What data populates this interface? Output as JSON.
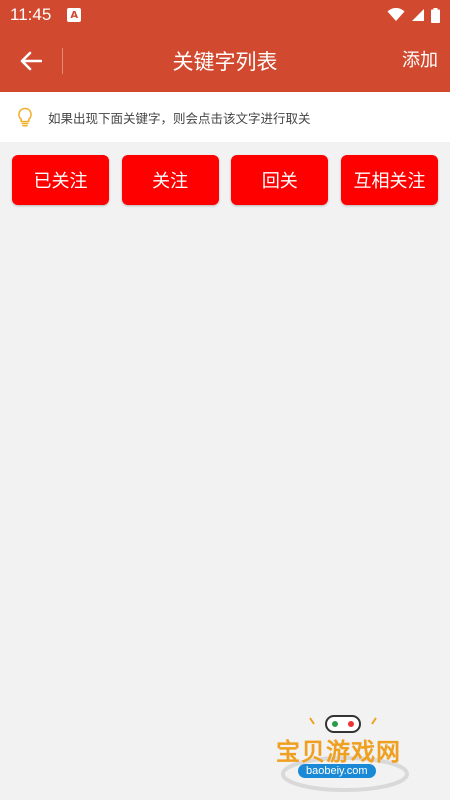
{
  "status_bar": {
    "time": "11:45",
    "notification_glyph": "A"
  },
  "toolbar": {
    "title": "关键字列表",
    "add_label": "添加"
  },
  "hint": {
    "icon": "lightbulb-icon",
    "text": "如果出现下面关键字，则会点击该文字进行取关"
  },
  "keywords": [
    "已关注",
    "关注",
    "回关",
    "互相关注"
  ],
  "watermark": {
    "title": "宝贝游戏网",
    "url": "baobeiy.com"
  },
  "colors": {
    "header": "#d14a2f",
    "button": "#ff0000",
    "background": "#f2f2f2",
    "hint_icon": "#f0b030"
  }
}
